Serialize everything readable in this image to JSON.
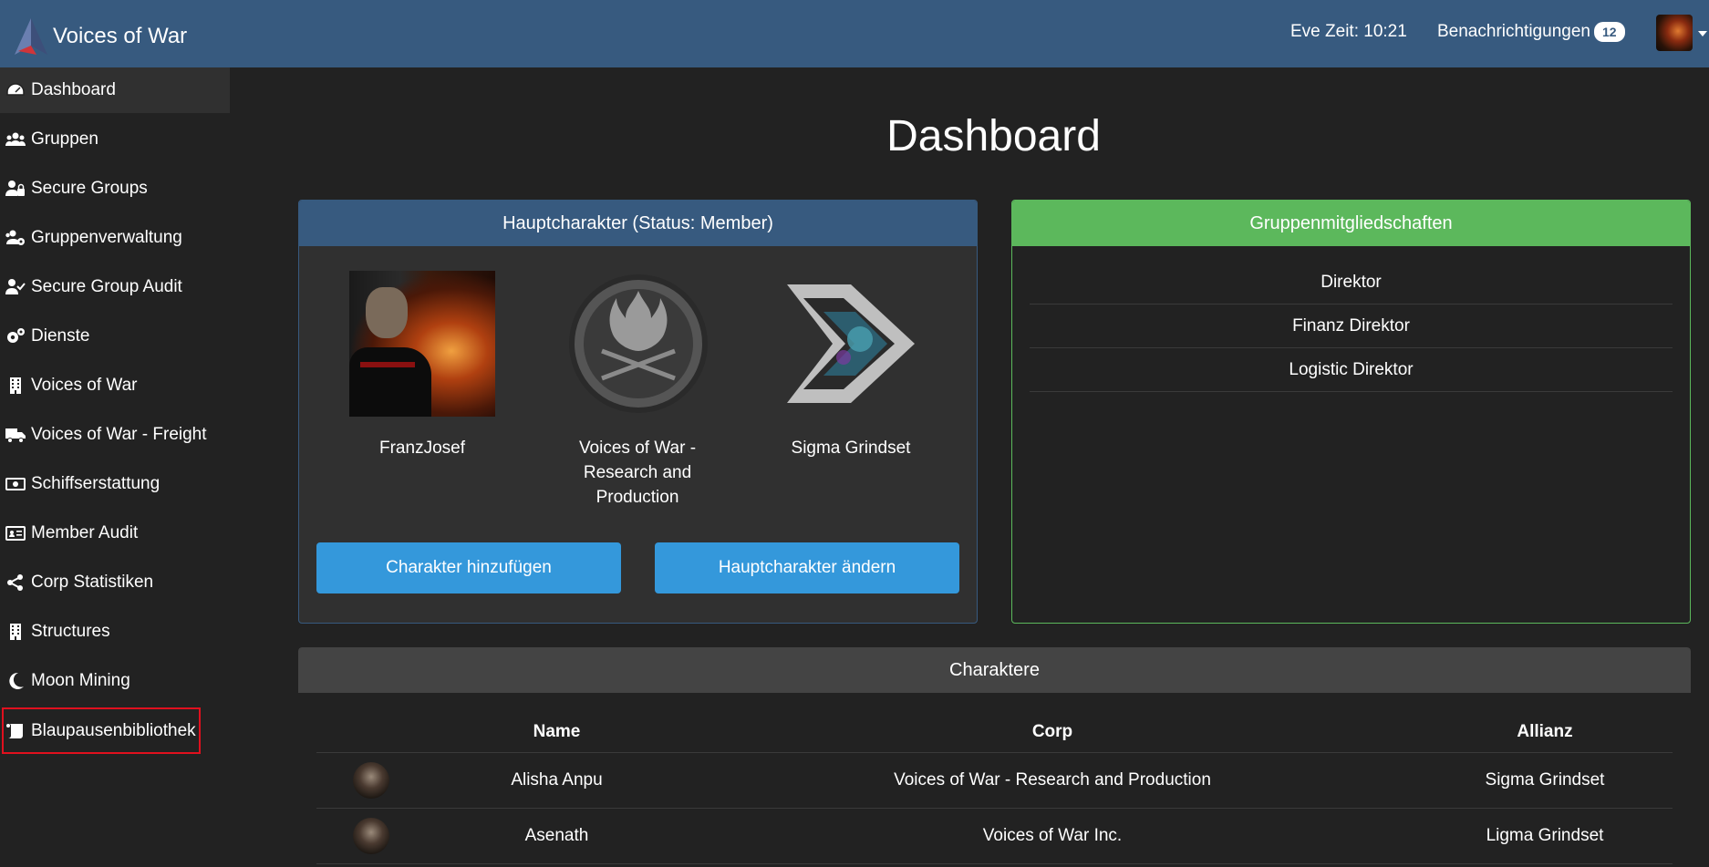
{
  "app": {
    "title": "Voices of War"
  },
  "header": {
    "eve_time": "Eve Zeit: 10:21",
    "notifications_label": "Benachrichtigungen",
    "notifications_count": "12"
  },
  "sidebar": {
    "items": [
      {
        "label": "Dashboard",
        "icon": "tachometer-icon"
      },
      {
        "label": "Gruppen",
        "icon": "users-icon"
      },
      {
        "label": "Secure Groups",
        "icon": "user-lock-icon"
      },
      {
        "label": "Gruppenverwaltung",
        "icon": "users-cog-icon"
      },
      {
        "label": "Secure Group Audit",
        "icon": "user-check-icon"
      },
      {
        "label": "Dienste",
        "icon": "cogs-icon"
      },
      {
        "label": "Voices of War",
        "icon": "building-icon"
      },
      {
        "label": "Voices of War - Freight",
        "icon": "truck-icon"
      },
      {
        "label": "Schiffserstattung",
        "icon": "money-bill-icon"
      },
      {
        "label": "Member Audit",
        "icon": "id-card-icon"
      },
      {
        "label": "Corp Statistiken",
        "icon": "share-nodes-icon"
      },
      {
        "label": "Structures",
        "icon": "building-icon"
      },
      {
        "label": "Moon Mining",
        "icon": "moon-icon"
      },
      {
        "label": "Blaupausenbibliothek",
        "icon": "scroll-icon"
      }
    ]
  },
  "main": {
    "title": "Dashboard",
    "main_character": {
      "heading": "Hauptcharakter (Status: Member)",
      "character_name": "FranzJosef",
      "corp_name": "Voices of War - Research and Production",
      "alliance_name": "Sigma Grindset",
      "add_button": "Charakter hinzufügen",
      "change_button": "Hauptcharakter ändern"
    },
    "groups": {
      "heading": "Gruppenmitgliedschaften",
      "items": [
        "Direktor",
        "Finanz Direktor",
        "Logistic Direktor"
      ]
    },
    "characters": {
      "heading": "Charaktere",
      "columns": [
        "Name",
        "Corp",
        "Allianz"
      ],
      "rows": [
        {
          "name": "Alisha Anpu",
          "corp": "Voices of War - Research and Production",
          "alliance": "Sigma Grindset"
        },
        {
          "name": "Asenath",
          "corp": "Voices of War Inc.",
          "alliance": "Ligma Grindset"
        }
      ]
    }
  },
  "colors": {
    "navbar": "#375a7f",
    "background": "#222222",
    "card": "#303030",
    "success": "#5cb85c",
    "button": "#3498db",
    "highlight_outline": "#e0101e"
  }
}
